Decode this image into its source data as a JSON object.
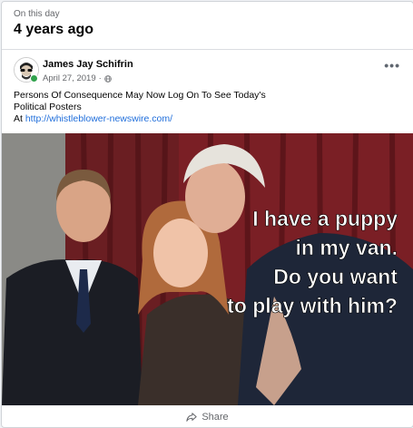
{
  "memory": {
    "label": "On this day",
    "title": "4 years ago"
  },
  "post": {
    "author": "James Jay Schifrin",
    "date": "April 27, 2019",
    "separator": "·",
    "audience_icon": "globe-icon",
    "text_line1": "Persons Of Consequence May Now Log On To See Today's",
    "text_line2": "Political Posters",
    "link_prefix": "At",
    "link": "http://whistleblower-newswire.com/",
    "image_caption": [
      "I have a puppy",
      "in my van.",
      "Do you want",
      "to play with him?"
    ]
  },
  "actions": {
    "more_icon": "more-options-icon",
    "more_label": "•••",
    "share": "Share",
    "share_icon": "share-icon"
  },
  "colors": {
    "link": "#216fdb",
    "online": "#31a24c",
    "muted": "#65676b"
  }
}
